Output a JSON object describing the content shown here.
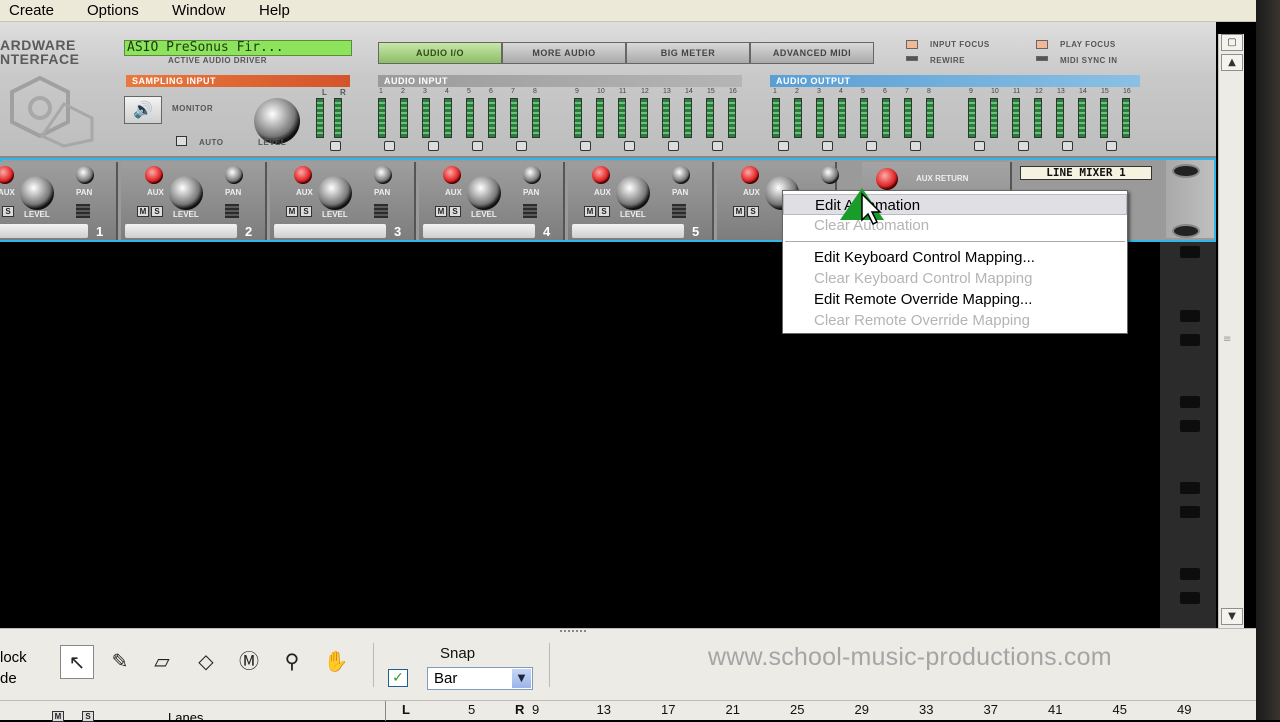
{
  "menu": [
    "Create",
    "Options",
    "Window",
    "Help"
  ],
  "hardware": {
    "title_line1": "ARDWARE",
    "title_line2": "NTERFACE",
    "driver_display": "ASIO PreSonus Fir...",
    "driver_caption": "ACTIVE AUDIO DRIVER",
    "tabs": [
      "AUDIO I/O",
      "MORE AUDIO",
      "BIG METER",
      "ADVANCED MIDI"
    ],
    "indicators": [
      "INPUT FOCUS",
      "REWIRE",
      "PLAY FOCUS",
      "MIDI SYNC IN"
    ],
    "sampling_input": "SAMPLING INPUT",
    "audio_input": "AUDIO INPUT",
    "audio_output": "AUDIO OUTPUT",
    "monitor": "MONITOR",
    "auto": "AUTO",
    "level": "LEVEL",
    "lr": [
      "L",
      "R"
    ],
    "channel_numbers": [
      "1",
      "2",
      "3",
      "4",
      "5",
      "6",
      "7",
      "8",
      "9",
      "10",
      "11",
      "12",
      "13",
      "14",
      "15",
      "16"
    ]
  },
  "mixer": {
    "aux": "AUX",
    "pan": "PAN",
    "level": "LEVEL",
    "m": "M",
    "s": "S",
    "channels": [
      "1",
      "2",
      "3",
      "4",
      "5"
    ],
    "aux_return": "AUX RETURN",
    "device_name": "LINE MIXER 1"
  },
  "context_menu": {
    "items": [
      {
        "label": "Edit Automation",
        "enabled": true,
        "highlighted": true
      },
      {
        "label": "Clear Automation",
        "enabled": false
      },
      {
        "label": "Edit Keyboard Control Mapping...",
        "enabled": true
      },
      {
        "label": "Clear Keyboard Control Mapping",
        "enabled": false
      },
      {
        "label": "Edit Remote Override Mapping...",
        "enabled": true
      },
      {
        "label": "Clear Remote Override Mapping",
        "enabled": false
      }
    ]
  },
  "toolbar": {
    "left_text_1": "lock",
    "left_text_2": "de",
    "snap_label": "Snap",
    "snap_checked": true,
    "snap_value": "Bar",
    "watermark": "www.school-music-productions.com",
    "m": "M",
    "s": "S",
    "lanes_label": "Lanes"
  },
  "ruler": {
    "left_marker": "L",
    "right_marker": "R",
    "bars": [
      "5",
      "9",
      "13",
      "17",
      "21",
      "25",
      "29",
      "33",
      "37",
      "41",
      "45",
      "49"
    ]
  },
  "colors": {
    "accent_cyan": "#2fb7e9",
    "lcd_green": "#8ee35d",
    "sampling_orange": "#e8793e",
    "audio_output_blue": "#5a9fd4"
  }
}
